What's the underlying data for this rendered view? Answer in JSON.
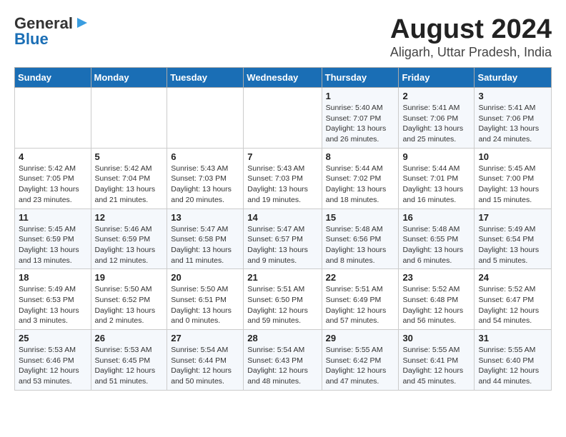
{
  "logo": {
    "line1": "General",
    "line2": "Blue"
  },
  "title": "August 2024",
  "subtitle": "Aligarh, Uttar Pradesh, India",
  "weekdays": [
    "Sunday",
    "Monday",
    "Tuesday",
    "Wednesday",
    "Thursday",
    "Friday",
    "Saturday"
  ],
  "weeks": [
    [
      {
        "day": "",
        "info": ""
      },
      {
        "day": "",
        "info": ""
      },
      {
        "day": "",
        "info": ""
      },
      {
        "day": "",
        "info": ""
      },
      {
        "day": "1",
        "info": "Sunrise: 5:40 AM\nSunset: 7:07 PM\nDaylight: 13 hours\nand 26 minutes."
      },
      {
        "day": "2",
        "info": "Sunrise: 5:41 AM\nSunset: 7:06 PM\nDaylight: 13 hours\nand 25 minutes."
      },
      {
        "day": "3",
        "info": "Sunrise: 5:41 AM\nSunset: 7:06 PM\nDaylight: 13 hours\nand 24 minutes."
      }
    ],
    [
      {
        "day": "4",
        "info": "Sunrise: 5:42 AM\nSunset: 7:05 PM\nDaylight: 13 hours\nand 23 minutes."
      },
      {
        "day": "5",
        "info": "Sunrise: 5:42 AM\nSunset: 7:04 PM\nDaylight: 13 hours\nand 21 minutes."
      },
      {
        "day": "6",
        "info": "Sunrise: 5:43 AM\nSunset: 7:03 PM\nDaylight: 13 hours\nand 20 minutes."
      },
      {
        "day": "7",
        "info": "Sunrise: 5:43 AM\nSunset: 7:03 PM\nDaylight: 13 hours\nand 19 minutes."
      },
      {
        "day": "8",
        "info": "Sunrise: 5:44 AM\nSunset: 7:02 PM\nDaylight: 13 hours\nand 18 minutes."
      },
      {
        "day": "9",
        "info": "Sunrise: 5:44 AM\nSunset: 7:01 PM\nDaylight: 13 hours\nand 16 minutes."
      },
      {
        "day": "10",
        "info": "Sunrise: 5:45 AM\nSunset: 7:00 PM\nDaylight: 13 hours\nand 15 minutes."
      }
    ],
    [
      {
        "day": "11",
        "info": "Sunrise: 5:45 AM\nSunset: 6:59 PM\nDaylight: 13 hours\nand 13 minutes."
      },
      {
        "day": "12",
        "info": "Sunrise: 5:46 AM\nSunset: 6:59 PM\nDaylight: 13 hours\nand 12 minutes."
      },
      {
        "day": "13",
        "info": "Sunrise: 5:47 AM\nSunset: 6:58 PM\nDaylight: 13 hours\nand 11 minutes."
      },
      {
        "day": "14",
        "info": "Sunrise: 5:47 AM\nSunset: 6:57 PM\nDaylight: 13 hours\nand 9 minutes."
      },
      {
        "day": "15",
        "info": "Sunrise: 5:48 AM\nSunset: 6:56 PM\nDaylight: 13 hours\nand 8 minutes."
      },
      {
        "day": "16",
        "info": "Sunrise: 5:48 AM\nSunset: 6:55 PM\nDaylight: 13 hours\nand 6 minutes."
      },
      {
        "day": "17",
        "info": "Sunrise: 5:49 AM\nSunset: 6:54 PM\nDaylight: 13 hours\nand 5 minutes."
      }
    ],
    [
      {
        "day": "18",
        "info": "Sunrise: 5:49 AM\nSunset: 6:53 PM\nDaylight: 13 hours\nand 3 minutes."
      },
      {
        "day": "19",
        "info": "Sunrise: 5:50 AM\nSunset: 6:52 PM\nDaylight: 13 hours\nand 2 minutes."
      },
      {
        "day": "20",
        "info": "Sunrise: 5:50 AM\nSunset: 6:51 PM\nDaylight: 13 hours\nand 0 minutes."
      },
      {
        "day": "21",
        "info": "Sunrise: 5:51 AM\nSunset: 6:50 PM\nDaylight: 12 hours\nand 59 minutes."
      },
      {
        "day": "22",
        "info": "Sunrise: 5:51 AM\nSunset: 6:49 PM\nDaylight: 12 hours\nand 57 minutes."
      },
      {
        "day": "23",
        "info": "Sunrise: 5:52 AM\nSunset: 6:48 PM\nDaylight: 12 hours\nand 56 minutes."
      },
      {
        "day": "24",
        "info": "Sunrise: 5:52 AM\nSunset: 6:47 PM\nDaylight: 12 hours\nand 54 minutes."
      }
    ],
    [
      {
        "day": "25",
        "info": "Sunrise: 5:53 AM\nSunset: 6:46 PM\nDaylight: 12 hours\nand 53 minutes."
      },
      {
        "day": "26",
        "info": "Sunrise: 5:53 AM\nSunset: 6:45 PM\nDaylight: 12 hours\nand 51 minutes."
      },
      {
        "day": "27",
        "info": "Sunrise: 5:54 AM\nSunset: 6:44 PM\nDaylight: 12 hours\nand 50 minutes."
      },
      {
        "day": "28",
        "info": "Sunrise: 5:54 AM\nSunset: 6:43 PM\nDaylight: 12 hours\nand 48 minutes."
      },
      {
        "day": "29",
        "info": "Sunrise: 5:55 AM\nSunset: 6:42 PM\nDaylight: 12 hours\nand 47 minutes."
      },
      {
        "day": "30",
        "info": "Sunrise: 5:55 AM\nSunset: 6:41 PM\nDaylight: 12 hours\nand 45 minutes."
      },
      {
        "day": "31",
        "info": "Sunrise: 5:55 AM\nSunset: 6:40 PM\nDaylight: 12 hours\nand 44 minutes."
      }
    ]
  ]
}
